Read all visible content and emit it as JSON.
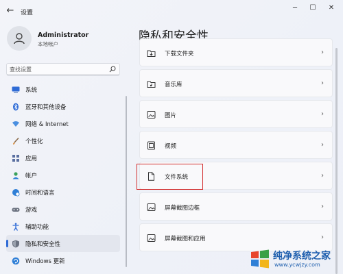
{
  "window": {
    "title": "设置",
    "controls": {
      "minimize": "─",
      "maximize": "☐",
      "close": "✕"
    },
    "back_glyph": "←"
  },
  "user": {
    "name": "Administrator",
    "account_type": "本地帐户"
  },
  "search": {
    "placeholder": "查找设置"
  },
  "sidebar": {
    "items": [
      {
        "label": "系统",
        "icon": "monitor-icon",
        "color": "#2f6bd6"
      },
      {
        "label": "蓝牙和其他设备",
        "icon": "bluetooth-icon",
        "color": "#2f6bd6"
      },
      {
        "label": "网络 & Internet",
        "icon": "wifi-icon",
        "color": "#4a8fe0"
      },
      {
        "label": "个性化",
        "icon": "brush-icon",
        "color": "#d98b3a"
      },
      {
        "label": "应用",
        "icon": "apps-icon",
        "color": "#5a6fa0"
      },
      {
        "label": "帐户",
        "icon": "person-icon",
        "color": "#3aa05a"
      },
      {
        "label": "时间和语言",
        "icon": "globe-clock-icon",
        "color": "#2f7fd6"
      },
      {
        "label": "游戏",
        "icon": "gamepad-icon",
        "color": "#6b7280"
      },
      {
        "label": "辅助功能",
        "icon": "accessibility-icon",
        "color": "#2f6bd6"
      },
      {
        "label": "隐私和安全性",
        "icon": "shield-icon",
        "color": "#6b7280",
        "selected": true
      },
      {
        "label": "Windows 更新",
        "icon": "update-icon",
        "color": "#2f7fd6"
      }
    ]
  },
  "main": {
    "title": "隐私和安全性",
    "rows": [
      {
        "label": "下载文件夹",
        "icon": "download-folder-icon"
      },
      {
        "label": "音乐库",
        "icon": "music-folder-icon"
      },
      {
        "label": "图片",
        "icon": "picture-icon"
      },
      {
        "label": "视频",
        "icon": "video-icon"
      },
      {
        "label": "文件系统",
        "icon": "document-icon"
      },
      {
        "label": "屏幕截图边框",
        "icon": "screenshot-border-icon"
      },
      {
        "label": "屏幕截图和应用",
        "icon": "screenshot-apps-icon"
      }
    ],
    "chevron": "›"
  },
  "watermark": {
    "text": "纯净系统之家",
    "url": "www.ycwjzy.com"
  }
}
